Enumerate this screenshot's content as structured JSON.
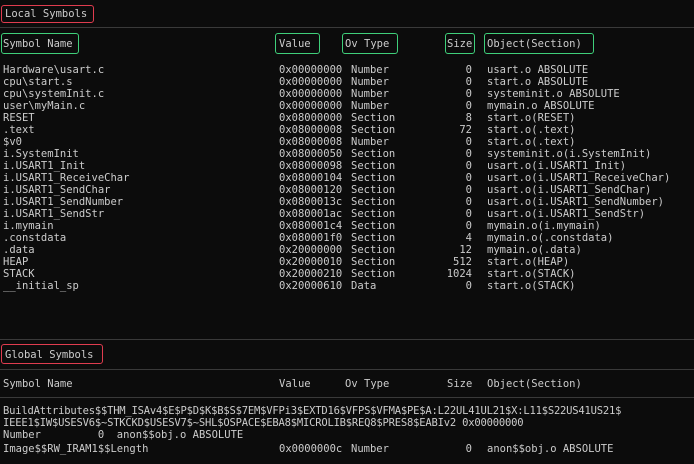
{
  "local_title": "Local Symbols",
  "local_headers": {
    "name": "Symbol Name",
    "value": "Value",
    "ov": "Ov",
    "type": "Type",
    "size": "Size",
    "object": "Object(Section)"
  },
  "local_rows": [
    {
      "name": "Hardware\\usart.c",
      "value": "0x00000000",
      "type": "Number",
      "size": "0",
      "object": "usart.o ABSOLUTE"
    },
    {
      "name": "cpu\\start.s",
      "value": "0x00000000",
      "type": "Number",
      "size": "0",
      "object": "start.o ABSOLUTE"
    },
    {
      "name": "cpu\\systemInit.c",
      "value": "0x00000000",
      "type": "Number",
      "size": "0",
      "object": "systeminit.o ABSOLUTE"
    },
    {
      "name": "user\\myMain.c",
      "value": "0x00000000",
      "type": "Number",
      "size": "0",
      "object": "mymain.o ABSOLUTE"
    },
    {
      "name": "RESET",
      "value": "0x08000000",
      "type": "Section",
      "size": "8",
      "object": "start.o(RESET)"
    },
    {
      "name": ".text",
      "value": "0x08000008",
      "type": "Section",
      "size": "72",
      "object": "start.o(.text)"
    },
    {
      "name": "$v0",
      "value": "0x08000008",
      "type": "Number",
      "size": "0",
      "object": "start.o(.text)"
    },
    {
      "name": "i.SystemInit",
      "value": "0x08000050",
      "type": "Section",
      "size": "0",
      "object": "systeminit.o(i.SystemInit)"
    },
    {
      "name": "i.USART1_Init",
      "value": "0x08000098",
      "type": "Section",
      "size": "0",
      "object": "usart.o(i.USART1_Init)"
    },
    {
      "name": "i.USART1_ReceiveChar",
      "value": "0x08000104",
      "type": "Section",
      "size": "0",
      "object": "usart.o(i.USART1_ReceiveChar)"
    },
    {
      "name": "i.USART1_SendChar",
      "value": "0x08000120",
      "type": "Section",
      "size": "0",
      "object": "usart.o(i.USART1_SendChar)"
    },
    {
      "name": "i.USART1_SendNumber",
      "value": "0x0800013c",
      "type": "Section",
      "size": "0",
      "object": "usart.o(i.USART1_SendNumber)"
    },
    {
      "name": "i.USART1_SendStr",
      "value": "0x080001ac",
      "type": "Section",
      "size": "0",
      "object": "usart.o(i.USART1_SendStr)"
    },
    {
      "name": "i.mymain",
      "value": "0x080001c4",
      "type": "Section",
      "size": "0",
      "object": "mymain.o(i.mymain)"
    },
    {
      "name": ".constdata",
      "value": "0x080001f0",
      "type": "Section",
      "size": "4",
      "object": "mymain.o(.constdata)"
    },
    {
      "name": ".data",
      "value": "0x20000000",
      "type": "Section",
      "size": "12",
      "object": "mymain.o(.data)"
    },
    {
      "name": "HEAP",
      "value": "0x20000010",
      "type": "Section",
      "size": "512",
      "object": "start.o(HEAP)"
    },
    {
      "name": "STACK",
      "value": "0x20000210",
      "type": "Section",
      "size": "1024",
      "object": "start.o(STACK)"
    },
    {
      "name": "__initial_sp",
      "value": "0x20000610",
      "type": "Data",
      "size": "0",
      "object": "start.o(STACK)"
    }
  ],
  "global_title": "Global Symbols",
  "global_headers": {
    "name": "Symbol Name",
    "value": "Value",
    "ov": "Ov",
    "type": "Type",
    "size": "Size",
    "object": "Object(Section)"
  },
  "global_wrap": {
    "line1": "BuildAttributes$$THM_ISAv4$E$P$D$K$B$S$7EM$VFPi3$EXTD16$VFPS$VFMA$PE$A:L22UL41UL21$X:L11$S22US41US21$",
    "line2": "IEEE1$IW$USESV6$~STKCKD$USESV7$~SHL$OSPACE$EBA8$MICROLIB$REQ8$PRES8$EABIv2 0x00000000",
    "line3": "Number         0  anon$$obj.o ABSOLUTE"
  },
  "global_last": {
    "name": "Image$$RW_IRAM1$$Length",
    "value": "0x0000000c",
    "type": "Number",
    "size": "0",
    "object": "anon$$obj.o ABSOLUTE"
  }
}
